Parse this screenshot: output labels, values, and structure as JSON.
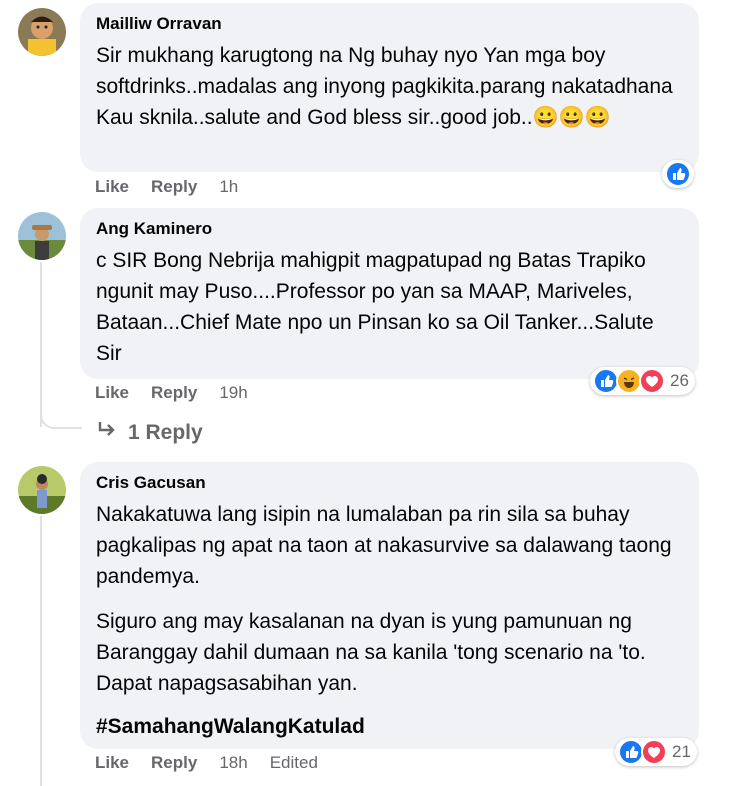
{
  "comments": [
    {
      "author": "Mailliw Orravan",
      "text": "Sir mukhang karugtong na Ng buhay nyo Yan mga boy softdrinks..madalas ang inyong pagkikita.parang nakatadhana Kau sknila..salute and God bless sir..good job..😀😀😀",
      "like": "Like",
      "reply": "Reply",
      "time": "1h",
      "reactions": [
        "like-icon"
      ],
      "reaction_count": ""
    },
    {
      "author": "Ang Kaminero",
      "text": "c SIR Bong Nebrija mahigpit magpatupad ng Batas Trapiko ngunit may Puso....Professor po yan sa MAAP, Mariveles, Bataan...Chief Mate npo un Pinsan ko sa Oil Tanker...Salute Sir",
      "like": "Like",
      "reply": "Reply",
      "time": "19h",
      "reactions": [
        "like-icon",
        "haha-icon",
        "heart-icon"
      ],
      "reaction_count": "26",
      "replies_link": "1 Reply"
    },
    {
      "author": "Cris Gacusan",
      "paragraphs": [
        "Nakakatuwa lang isipin na lumalaban pa rin sila sa buhay pagkalipas ng apat na taon at nakasurvive sa dalawang taong pandemya.",
        "Siguro ang may kasalanan na dyan is yung pamunuan ng Baranggay dahil dumaan na sa kanila 'tong scenario na 'to. Dapat napagsasabihan yan."
      ],
      "hashtag": "#SamahangWalangKatulad",
      "like": "Like",
      "reply": "Reply",
      "time": "18h",
      "edited": "Edited",
      "reactions": [
        "like-icon",
        "heart-icon"
      ],
      "reaction_count": "21"
    }
  ],
  "colors": {
    "like": "#1877f2",
    "heart": "#f33e58",
    "haha": "#f7b125",
    "bubble": "#f0f2f5",
    "meta": "#65676b"
  }
}
